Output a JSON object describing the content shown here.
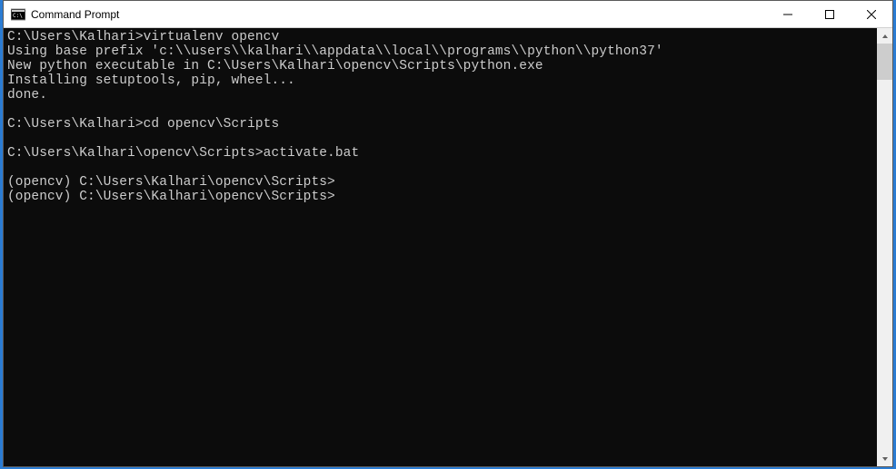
{
  "window": {
    "title": "Command Prompt"
  },
  "terminal": {
    "lines": [
      "C:\\Users\\Kalhari>virtualenv opencv",
      "Using base prefix 'c:\\\\users\\\\kalhari\\\\appdata\\\\local\\\\programs\\\\python\\\\python37'",
      "New python executable in C:\\Users\\Kalhari\\opencv\\Scripts\\python.exe",
      "Installing setuptools, pip, wheel...",
      "done.",
      "",
      "C:\\Users\\Kalhari>cd opencv\\Scripts",
      "",
      "C:\\Users\\Kalhari\\opencv\\Scripts>activate.bat",
      "",
      "(opencv) C:\\Users\\Kalhari\\opencv\\Scripts>",
      "(opencv) C:\\Users\\Kalhari\\opencv\\Scripts>"
    ]
  }
}
